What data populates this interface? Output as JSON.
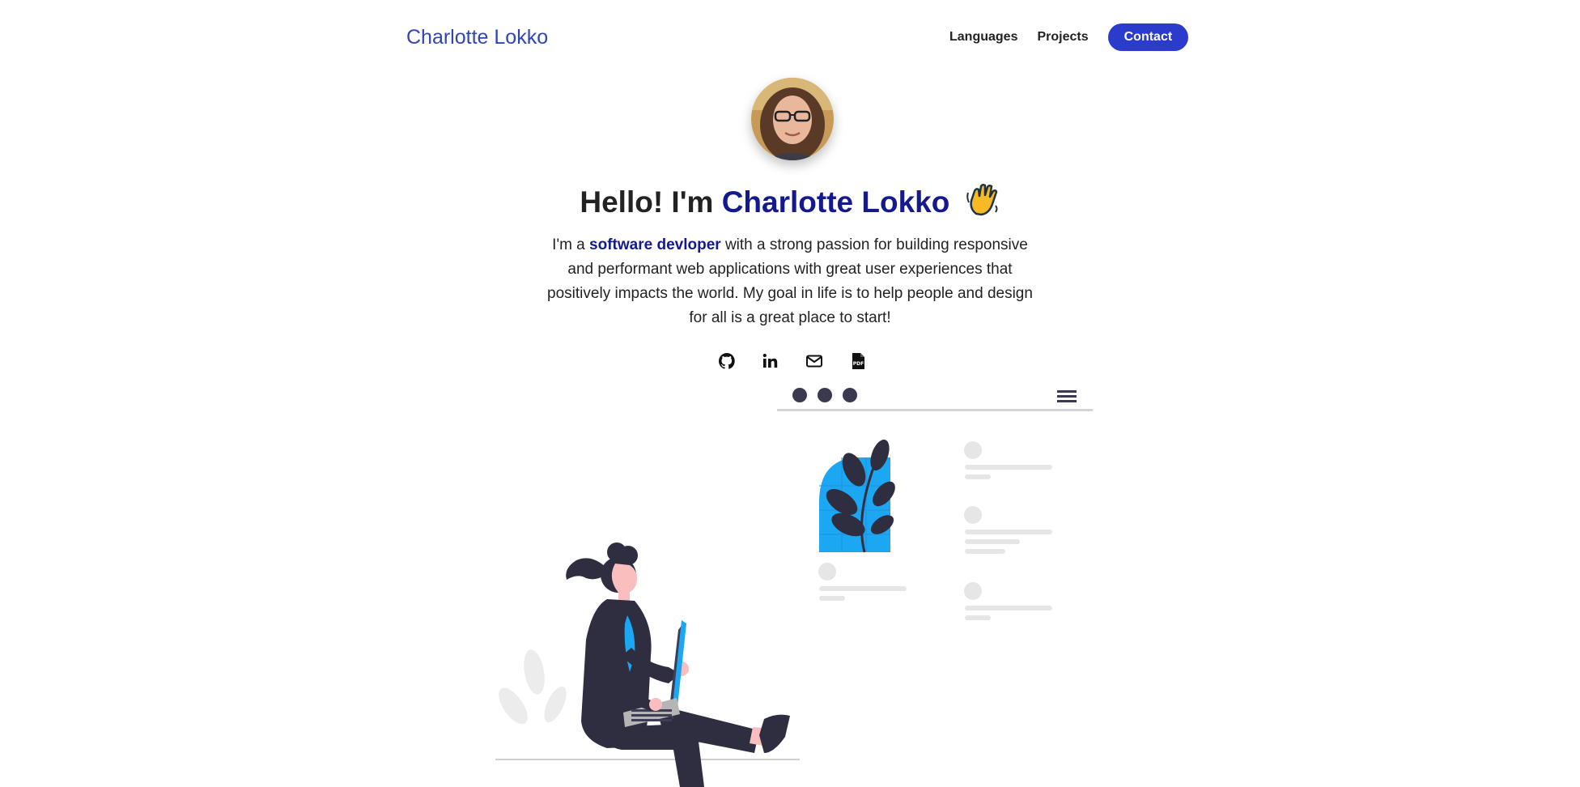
{
  "header": {
    "brand": "Charlotte Lokko",
    "nav": {
      "languages": "Languages",
      "projects": "Projects",
      "contact": "Contact"
    }
  },
  "hero": {
    "greeting": "Hello! I'm",
    "name": "Charlotte Lokko",
    "bio_prefix": "I'm a",
    "bio_accent": "software devloper",
    "bio_rest": "with a strong passion for building responsive and performant web applications with great user experiences that positively impacts the world. My goal in life is to help people and design for all is a great place to start!"
  },
  "socials": {
    "icons": [
      "github-icon",
      "linkedin-icon",
      "email-icon",
      "pdf-icon"
    ]
  },
  "colors": {
    "brand": "#2f45b8",
    "accent_dark": "#141a8e",
    "button": "#2b3bcb",
    "illustration_blue": "#0ea5ee",
    "illustration_dark": "#2f2e41"
  }
}
